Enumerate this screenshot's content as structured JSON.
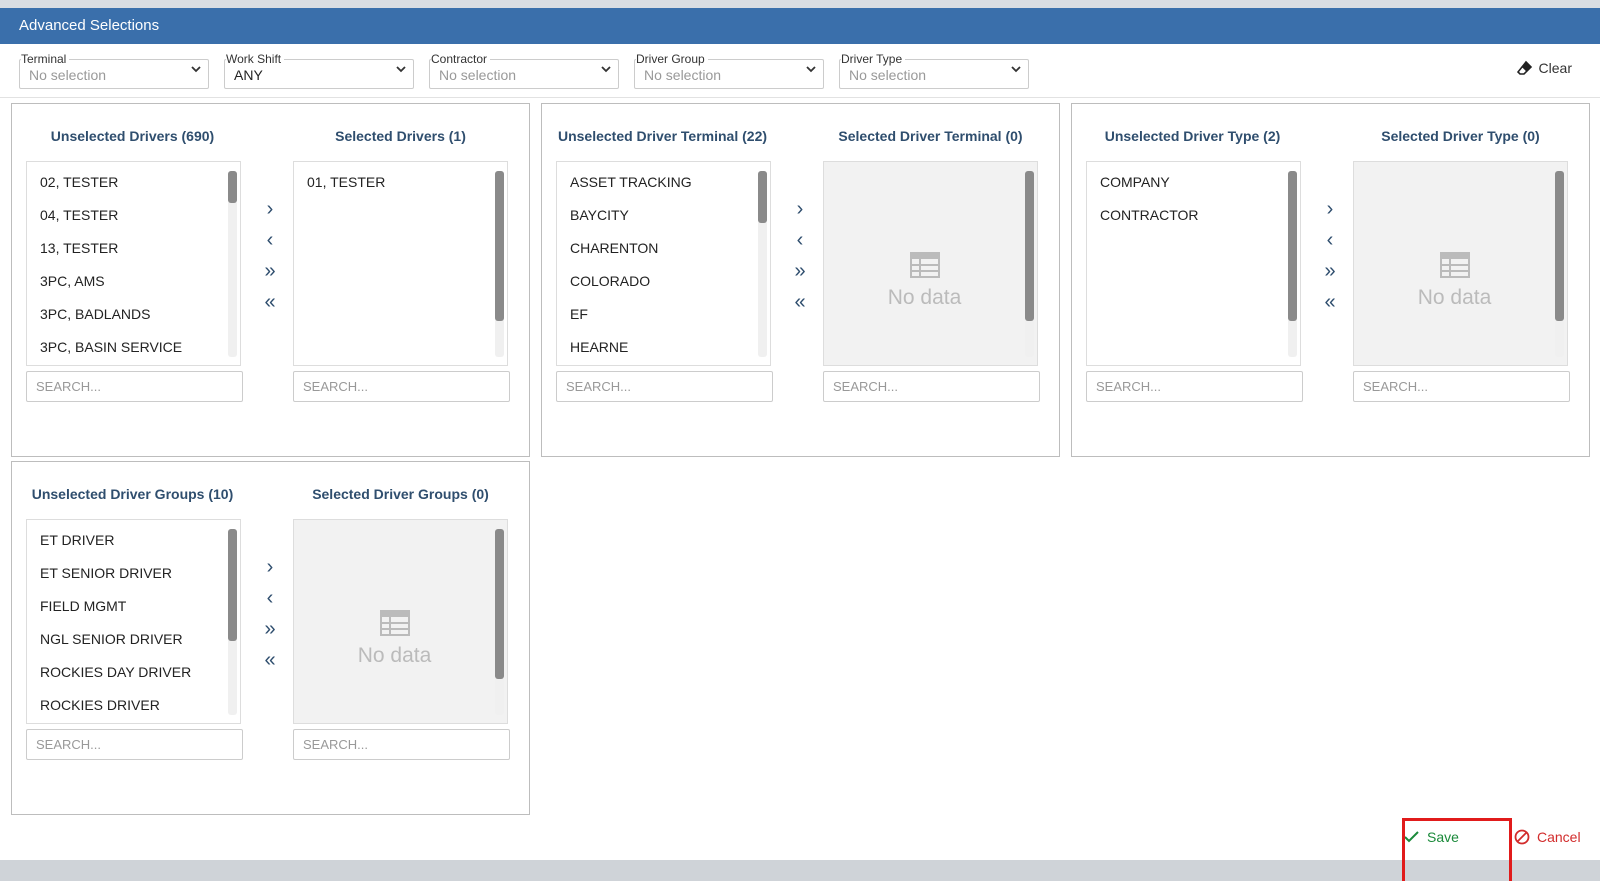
{
  "modal": {
    "title": "Advanced Selections"
  },
  "filters": {
    "terminal": {
      "label": "Terminal",
      "value": "No selection"
    },
    "work_shift": {
      "label": "Work Shift",
      "value": "ANY"
    },
    "contractor": {
      "label": "Contractor",
      "value": "No selection"
    },
    "driver_group": {
      "label": "Driver Group",
      "value": "No selection"
    },
    "driver_type": {
      "label": "Driver Type",
      "value": "No selection"
    },
    "clear_label": "Clear"
  },
  "panels": {
    "drivers": {
      "unselected_title": "Unselected Drivers (690)",
      "selected_title": "Selected Drivers (1)",
      "unselected_items": [
        "02, TESTER",
        "04, TESTER",
        "13, TESTER",
        "3PC, AMS",
        "3PC, BADLANDS",
        "3PC, BASIN SERVICE"
      ],
      "selected_items": [
        "01, TESTER"
      ],
      "selected_empty_text": "",
      "search_placeholder": "SEARCH..."
    },
    "terminal": {
      "unselected_title": "Unselected Driver Terminal (22)",
      "selected_title": "Selected Driver Terminal (0)",
      "unselected_items": [
        "ASSET TRACKING",
        "BAYCITY",
        "CHARENTON",
        "COLORADO",
        "EF",
        "HEARNE"
      ],
      "selected_items": [],
      "selected_empty_text": "No data",
      "search_placeholder": "SEARCH..."
    },
    "type": {
      "unselected_title": "Unselected Driver Type (2)",
      "selected_title": "Selected Driver Type (0)",
      "unselected_items": [
        "COMPANY",
        "CONTRACTOR"
      ],
      "selected_items": [],
      "selected_empty_text": "No data",
      "search_placeholder": "SEARCH..."
    },
    "groups": {
      "unselected_title": "Unselected Driver Groups (10)",
      "selected_title": "Selected Driver Groups (0)",
      "unselected_items": [
        "ET DRIVER",
        "ET SENIOR DRIVER",
        "FIELD MGMT",
        "NGL SENIOR DRIVER",
        "ROCKIES DAY DRIVER",
        "ROCKIES DRIVER"
      ],
      "selected_items": [],
      "selected_empty_text": "No data",
      "search_placeholder": "SEARCH..."
    }
  },
  "transfer_arrows": {
    "move_right": "›",
    "move_left": "‹",
    "move_all_right": "»",
    "move_all_left": "«"
  },
  "footer": {
    "save_label": "Save",
    "cancel_label": "Cancel"
  },
  "colors": {
    "header": "#3a6fab",
    "title_text": "#2f4e6e",
    "save": "#1a8a3a",
    "cancel": "#d22c2c",
    "highlight": "#e11b1b"
  }
}
